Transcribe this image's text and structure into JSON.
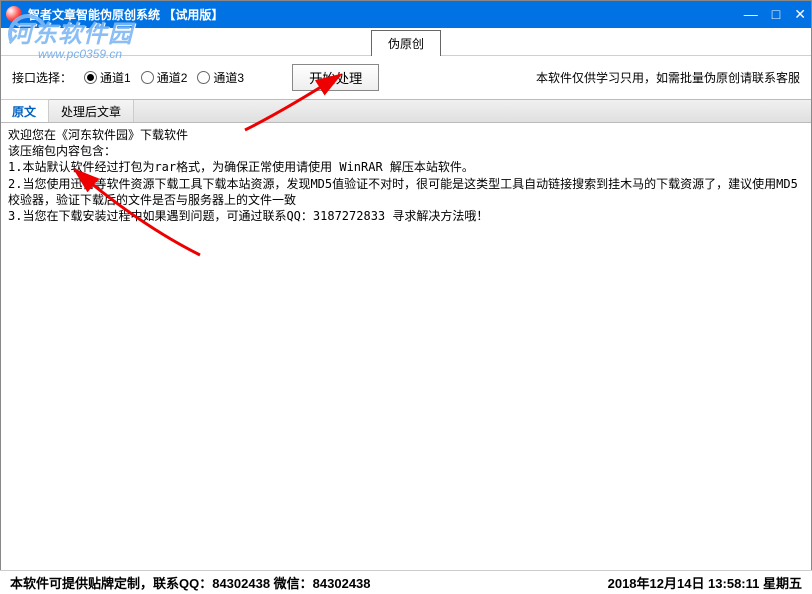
{
  "titlebar": {
    "title": "智者文章智能伪原创系统 【试用版】"
  },
  "toolbar_tab": "伪原创",
  "options": {
    "label": "接口选择：",
    "channels": [
      "通道1",
      "通道2",
      "通道3"
    ],
    "selected": 0,
    "process_button": "开始处理",
    "notice": "本软件仅供学习只用，如需批量伪原创请联系客服"
  },
  "content_tabs": {
    "tab1": "原文",
    "tab2": "处理后文章"
  },
  "content": {
    "line0": "欢迎您在《河东软件园》下载软件",
    "line1": "该压缩包内容包含：",
    "line2": "1.本站默认软件经过打包为rar格式，为确保正常使用请使用 WinRAR 解压本站软件。",
    "line3": "2.当您使用迅雷等软件资源下载工具下载本站资源，发现MD5值验证不对时，很可能是这类型工具自动链接搜索到挂木马的下载资源了，建议使用MD5校验器，验证下载后的文件是否与服务器上的文件一致",
    "line4": "3.当您在下载安装过程中如果遇到问题，可通过联系QQ：3187272833 寻求解决方法哦！"
  },
  "statusbar": {
    "left": "本软件可提供贴牌定制，联系QQ：84302438 微信：84302438",
    "right": "2018年12月14日 13:58:11 星期五"
  },
  "watermark": {
    "text1": "河东软件园",
    "text2": "www.pc0359.cn"
  }
}
